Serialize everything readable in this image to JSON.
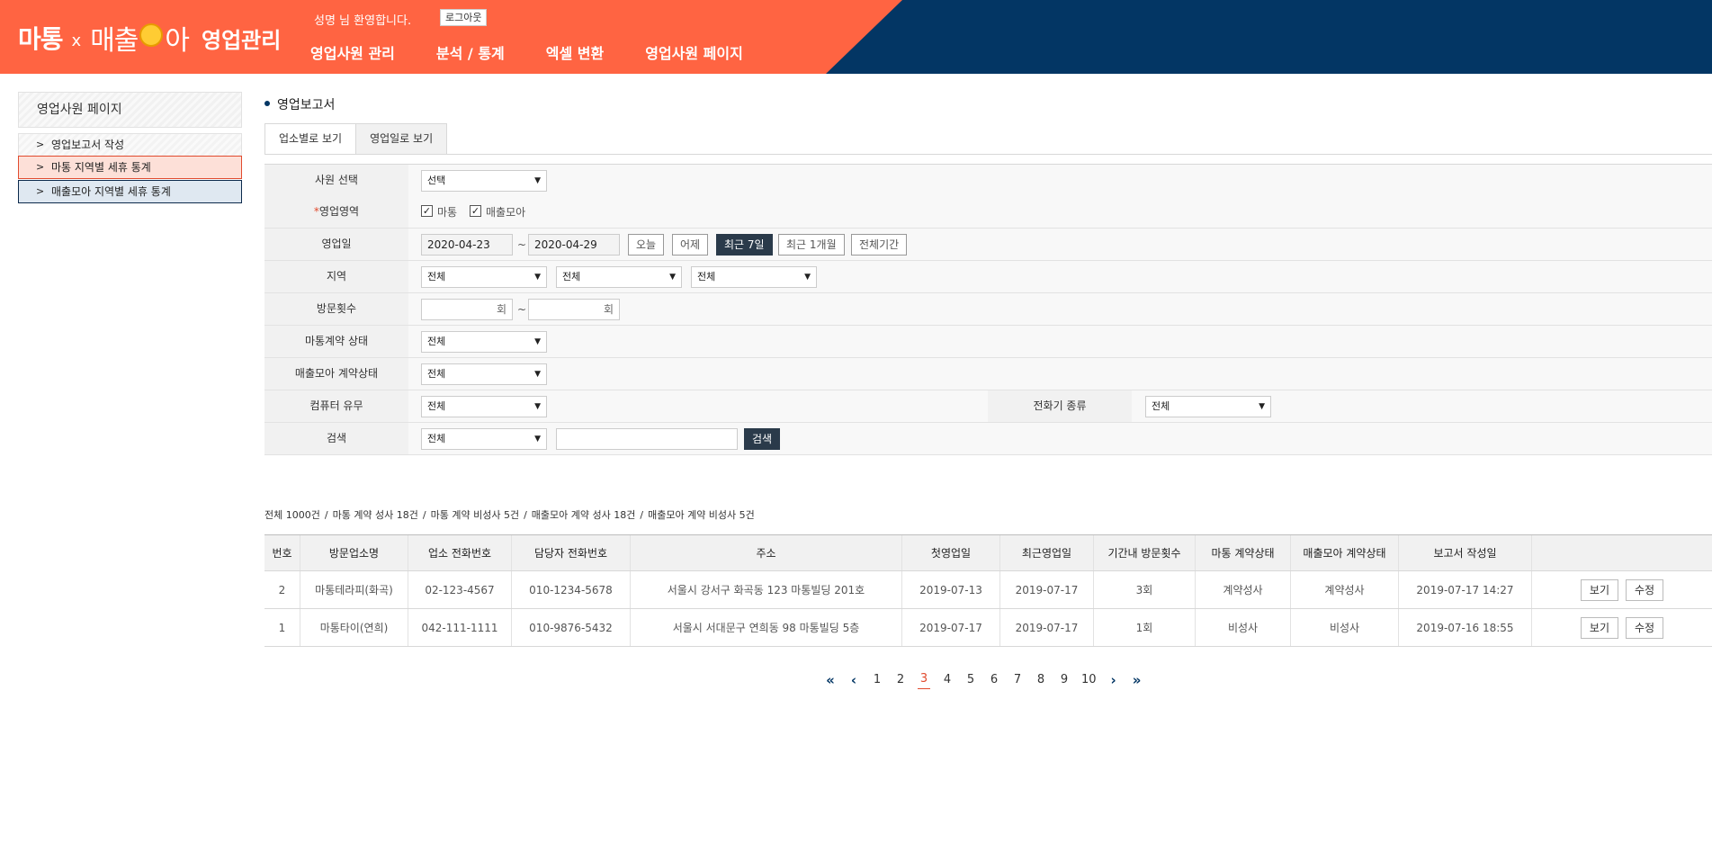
{
  "header": {
    "logo_matong": "마통",
    "logo_x": "x",
    "logo_maechul_1": "매출",
    "logo_maechul_2": "아",
    "logo_title": "영업관리",
    "welcome": "성명 님 환영합니다.",
    "logout": "로그아웃",
    "nav": [
      "영업사원 관리",
      "분석 / 통계",
      "엑셀 변환",
      "영업사원 페이지"
    ]
  },
  "sidebar": {
    "title": "영업사원 페이지",
    "items": [
      {
        "label": "영업보고서 작성"
      },
      {
        "label": "마통 지역별 세휴 통계"
      },
      {
        "label": "매출모아 지역별 세휴 통계"
      }
    ],
    "chevron_icon": "chevron-right-icon"
  },
  "content": {
    "title": "영업보고서",
    "tabs": [
      "업소별로 보기",
      "영업일로 보기"
    ]
  },
  "form": {
    "employee": {
      "label": "사원 선택",
      "value": "선택"
    },
    "area": {
      "label": "영업영역",
      "required_mark": "*",
      "options": [
        "마통",
        "매출모아"
      ],
      "checked": [
        true,
        true
      ]
    },
    "date": {
      "label": "영업일",
      "from": "2020-04-23",
      "tilde": "~",
      "to": "2020-04-29",
      "quick": [
        "오늘",
        "어제",
        "최근 7일",
        "최근 1개월",
        "전체기간"
      ],
      "active_quick": "최근 7일"
    },
    "region": {
      "label": "지역",
      "values": [
        "전체",
        "전체",
        "전체"
      ]
    },
    "visits": {
      "label": "방문횟수",
      "unit": "회",
      "tilde": "~"
    },
    "matong_status": {
      "label": "마통계약 상태",
      "value": "전체"
    },
    "maechul_status": {
      "label": "매출모아 계약상태",
      "value": "전체"
    },
    "computer": {
      "label": "컴퓨터 유무",
      "value": "전체"
    },
    "phone_type": {
      "label": "전화기 종류",
      "value": "전체"
    },
    "search": {
      "label": "검색",
      "value": "전체",
      "input": "",
      "button": "검색"
    },
    "dropdown_icon": "caret-down-icon"
  },
  "summary": {
    "items": [
      "전체 1000건",
      "마통 계약 성사 18건",
      "마통 계약 비성사 5건",
      "매출모아 계약 성사 18건",
      "매출모아 계약 비성사 5건"
    ],
    "separator": "/"
  },
  "table": {
    "headers": [
      "번호",
      "방문업소명",
      "업소 전화번호",
      "담당자 전화번호",
      "주소",
      "첫영업일",
      "최근영업일",
      "기간내 방문횟수",
      "마통 계약상태",
      "매출모아 계약상태",
      "보고서 작성일",
      ""
    ],
    "rows": [
      {
        "cells": [
          "2",
          "마통테라피(화곡)",
          "02-123-4567",
          "010-1234-5678",
          "서울시 강서구 화곡동 123 마통빌딩 201호",
          "2019-07-13",
          "2019-07-17",
          "3회",
          "계약성사",
          "계약성사",
          "2019-07-17 14:27"
        ],
        "view": "보기",
        "edit": "수정"
      },
      {
        "cells": [
          "1",
          "마통타이(연희)",
          "042-111-1111",
          "010-9876-5432",
          "서울시 서대문구 연희동 98 마통빌딩 5층",
          "2019-07-17",
          "2019-07-17",
          "1회",
          "비성사",
          "비성사",
          "2019-07-16 18:55"
        ],
        "view": "보기",
        "edit": "수정"
      }
    ]
  },
  "pagination": {
    "first": "«",
    "prev": "‹",
    "next": "›",
    "last": "»",
    "pages": [
      "1",
      "2",
      "3",
      "4",
      "5",
      "6",
      "7",
      "8",
      "9",
      "10"
    ],
    "current": "3"
  },
  "colors": {
    "brand_orange": "#ff6442",
    "brand_navy": "#033664",
    "accent_red": "#e14b2f",
    "dark_button": "#2a3a4a"
  }
}
